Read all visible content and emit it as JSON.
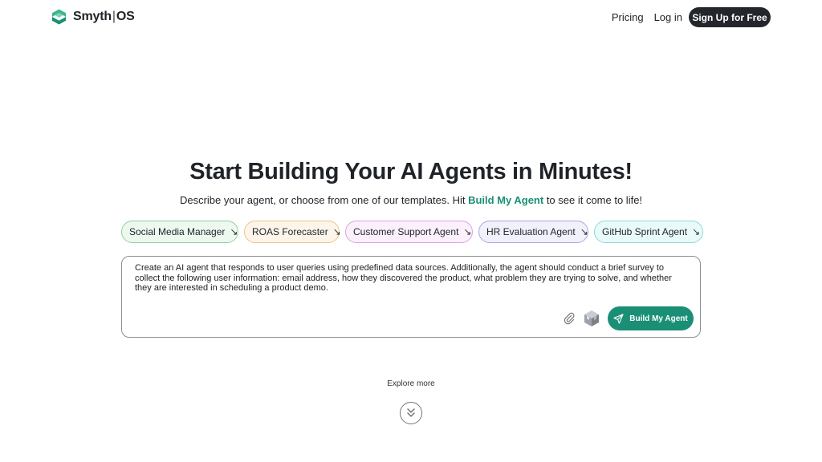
{
  "header": {
    "logo_left": "Smyth",
    "logo_sep": "|",
    "logo_right": "OS",
    "nav": {
      "pricing": "Pricing",
      "login": "Log in",
      "signup": "Sign Up for Free"
    }
  },
  "hero": {
    "title": "Start Building Your AI Agents in Minutes!",
    "sub_before": "Describe your agent, or choose from one of our templates. Hit ",
    "sub_accent": "Build My Agent",
    "sub_after": " to see it come to life!"
  },
  "templates": [
    {
      "label": "Social Media Manager",
      "arrow": "↘",
      "bg": "#edf8ef",
      "border": "#8fd1a3"
    },
    {
      "label": "ROAS Forecaster",
      "arrow": "↘",
      "bg": "#fdf5ea",
      "border": "#ecc48d"
    },
    {
      "label": "Customer Support Agent",
      "arrow": "↘",
      "bg": "#fbf0fb",
      "border": "#dba3e0"
    },
    {
      "label": "HR Evaluation Agent",
      "arrow": "↘",
      "bg": "#f1f1fb",
      "border": "#a9a8dc"
    },
    {
      "label": "GitHub Sprint Agent",
      "arrow": "↘",
      "bg": "#e9fafa",
      "border": "#8cdada"
    }
  ],
  "prompt": {
    "text": "Create an AI agent that responds to user queries using predefined data sources. Additionally, the agent should conduct a brief survey to collect the following user information: email address, how they discovered the product, what problem they are trying to solve, and whether they are interested in scheduling a product demo.",
    "attach_icon": "paperclip-icon",
    "cube_icon": "cube-icon",
    "build_label": "Build My Agent",
    "build_icon": "send-icon"
  },
  "explore": {
    "label": "Explore more",
    "icon": "double-chevron-down-icon"
  },
  "colors": {
    "accent": "#1a8f75",
    "dark_button": "#23272b"
  }
}
